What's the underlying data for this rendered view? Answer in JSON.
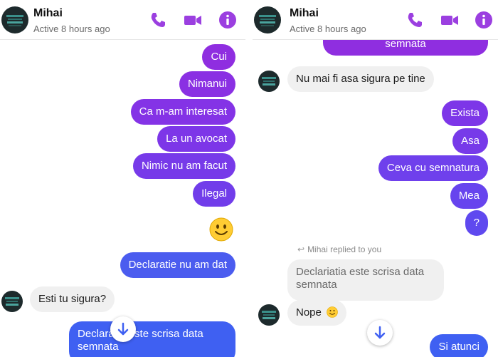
{
  "colors": {
    "accent": "#7a2ee6",
    "purple": "#8a2be2",
    "violet": "#6f40f0",
    "blue": "#3f5ff3",
    "icon": "#9b3fe0"
  },
  "left": {
    "header": {
      "name": "Mihai",
      "status": "Active 8 hours ago",
      "icons": [
        "phone-icon",
        "video-icon",
        "info-icon"
      ]
    },
    "messages": [
      {
        "text": "Cui"
      },
      {
        "text": "Nimanui"
      },
      {
        "text": "Ca m-am interesat"
      },
      {
        "text": "La un avocat"
      },
      {
        "text": "Nimic nu am facut"
      },
      {
        "text": "Ilegal"
      },
      {
        "emoji": "slightly-smiling-face"
      },
      {
        "text": "Declaratie nu am dat"
      },
      {
        "text": "Esti tu sigura?"
      },
      {
        "text": "Declaratia este scrisa data",
        "text2": "semnata"
      }
    ]
  },
  "right": {
    "header": {
      "name": "Mihai",
      "status": "Active 8 hours ago",
      "icons": [
        "phone-icon",
        "video-icon",
        "info-icon"
      ]
    },
    "messages": [
      {
        "text": "semnata"
      },
      {
        "text": "Nu mai fi asa sigura pe tine"
      },
      {
        "text": "Exista"
      },
      {
        "text": "Asa"
      },
      {
        "text": "Ceva cu semnatura"
      },
      {
        "text": "Mea"
      },
      {
        "text": "?"
      },
      {
        "text": "Mihai replied to you"
      },
      {
        "text": "Declariatia este scrisa data",
        "text2": "semnata"
      },
      {
        "text": "Nope"
      },
      {
        "text": "Si atunci"
      }
    ]
  }
}
